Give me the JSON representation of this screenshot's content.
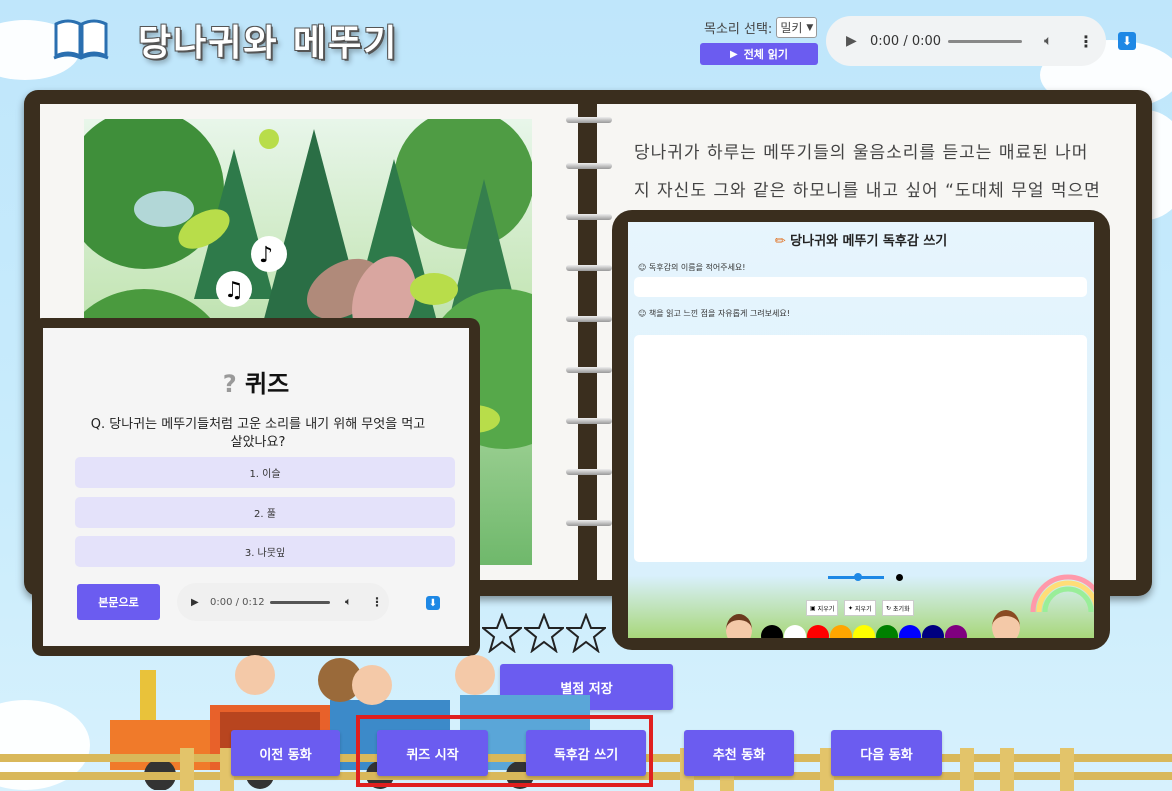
{
  "header": {
    "title": "당나귀와 메뚜기",
    "voice_label": "목소리 선택:",
    "voice_selected": "밀키",
    "read_all_label": "전체 읽기",
    "audio_time": "0:00 / 0:00"
  },
  "story": {
    "text": "당나귀가 하루는 메뚜기들의 울음소리를 듣고는 매료된 나머지 자신도 그와 같은 하모니를 내고 싶어 “도대체 무얼 먹으면 너"
  },
  "quiz": {
    "title": "퀴즈",
    "question": "Q. 당나귀는 메뚜기들처럼 고운 소리를 내기 위해 무엇을 먹고 살았나요?",
    "options": [
      "1. 이슬",
      "2. 풀",
      "3. 나뭇잎"
    ],
    "back_label": "본문으로",
    "audio_time": "0:00 / 0:12"
  },
  "writing": {
    "title": "당나귀와 메뚜기 독후감 쓰기",
    "name_label": "독후감의 이름을 적어주세요!",
    "draw_label": "책을 읽고 느낀 점을 자유롭게 그려보세요!",
    "tools": [
      "지우기",
      "지우기",
      "초기화"
    ],
    "colors": [
      "#000000",
      "#ffffff",
      "#ff0000",
      "#ffa500",
      "#ffff00",
      "#008000",
      "#0000ff",
      "#000080",
      "#800080"
    ]
  },
  "rating": {
    "stars": 5,
    "filled": 0,
    "save_label": "별점 저장"
  },
  "nav": {
    "prev_label": "이전 동화",
    "quiz_label": "퀴즈 시작",
    "write_label": "독후감 쓰기",
    "recommend_label": "추천 동화",
    "next_label": "다음 동화"
  }
}
